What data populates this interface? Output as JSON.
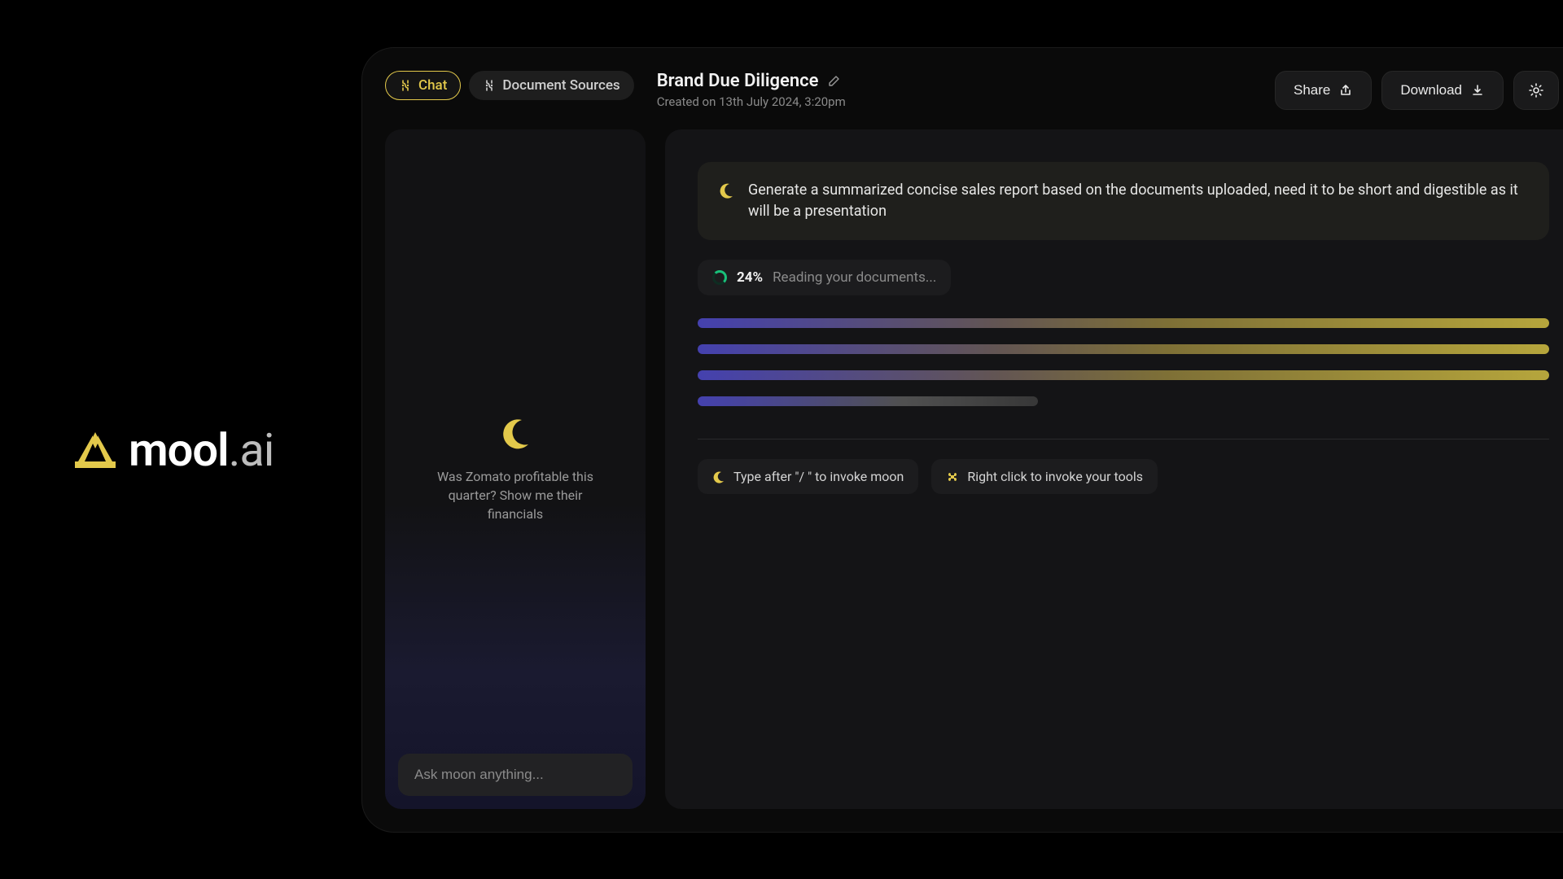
{
  "brand": {
    "name": "mool",
    "suffix": ".ai"
  },
  "tabs": {
    "chat": "Chat",
    "docs": "Document Sources"
  },
  "doc": {
    "title": "Brand Due Diligence",
    "meta": "Created on 13th July 2024, 3:20pm"
  },
  "actions": {
    "share": "Share",
    "download": "Download"
  },
  "chat": {
    "example": "Was Zomato profitable this quarter? Show me their financials",
    "placeholder": "Ask moon anything..."
  },
  "prompt": "Generate a summarized concise sales report based on the documents uploaded, need it to be short and digestible as it will be a presentation",
  "progress": {
    "pct": "24%",
    "status": "Reading your documents..."
  },
  "hints": {
    "slash": "Type after \"/ \" to invoke moon",
    "rightclick": "Right click to invoke your tools"
  }
}
